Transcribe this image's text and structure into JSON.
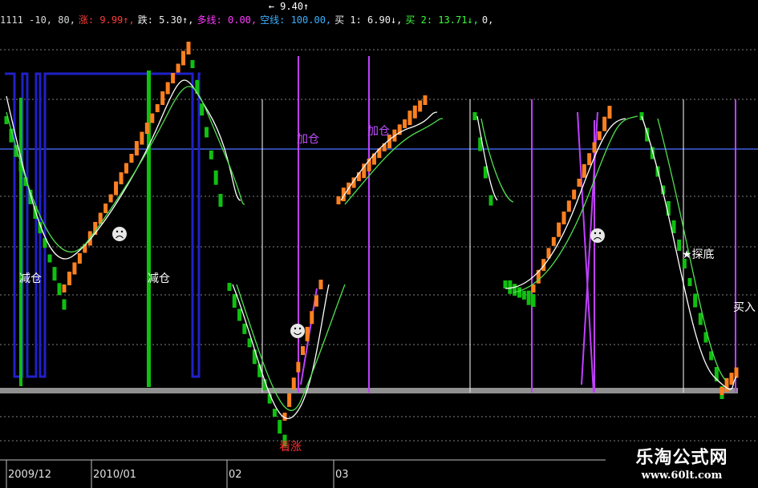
{
  "header": {
    "top_value": "← 9.40↑",
    "items": [
      {
        "text": "1111  -10, 80,",
        "color": "#d8d8d8"
      },
      {
        "text": "涨: 9.99↑,",
        "color": "#ff3b3b"
      },
      {
        "text": "跌: 5.30↑,",
        "color": "#f0f0f0"
      },
      {
        "text": "多线: 0.00,",
        "color": "#ff3bff"
      },
      {
        "text": "空线: 100.00,",
        "color": "#3bb0ff"
      },
      {
        "text": "买 1: 6.90↓,",
        "color": "#f0f0f0"
      },
      {
        "text": "买 2: 13.71↓,",
        "color": "#3bff3b"
      },
      {
        "text": "0,",
        "color": "#f0f0f0"
      }
    ]
  },
  "watermark": {
    "title": "乐淘公式网",
    "url": "www.60lt.com"
  },
  "colors": {
    "up": "#ff8020",
    "down": "#10c010",
    "white_line": "#ffffff",
    "green_line": "#50e050",
    "magenta": "#d040ff",
    "blue_thick": "#2020c8",
    "blue_line": "#4060e0",
    "gray_bar": "#909090",
    "label_red": "#ff3030",
    "label_white": "#ffffff",
    "label_magenta": "#c050ff"
  },
  "chart_data": {
    "type": "candlestick",
    "x_ticks": [
      "2009/12",
      "2010/01",
      "02",
      "03"
    ],
    "annotations": [
      {
        "text": "减仓",
        "color": "white"
      },
      {
        "text": "减仓",
        "color": "white"
      },
      {
        "text": "加仓",
        "color": "magenta"
      },
      {
        "text": "加仓",
        "color": "magenta"
      },
      {
        "text": "看涨",
        "color": "red"
      },
      {
        "text": "★探底",
        "color": "white"
      },
      {
        "text": "买入",
        "color": "white"
      }
    ]
  }
}
